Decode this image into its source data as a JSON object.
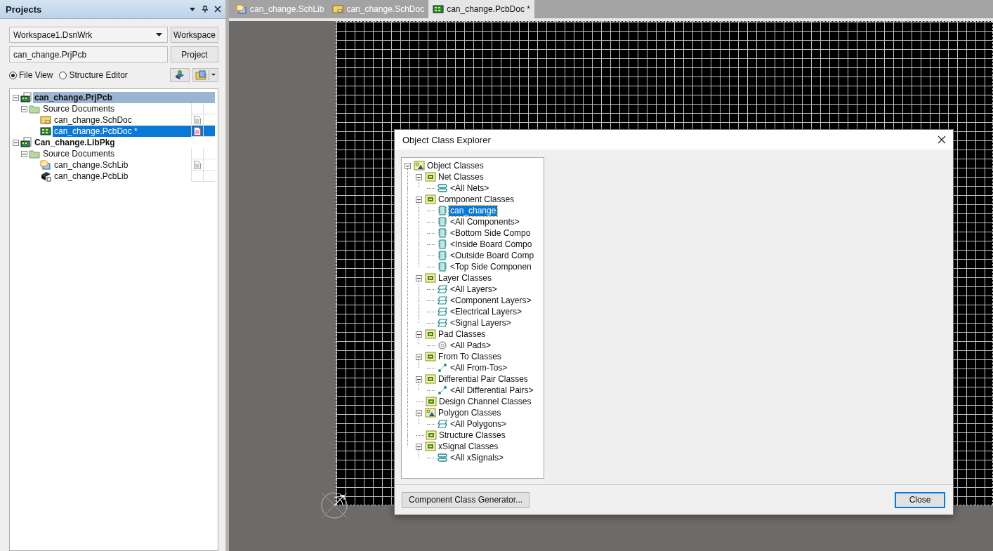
{
  "projects_panel": {
    "title": "Projects",
    "workspace_field": {
      "value": "Workspace1.DsnWrk"
    },
    "workspace_button": "Workspace",
    "project_field": {
      "value": "can_change.PrjPcb"
    },
    "project_button": "Project",
    "view_options": [
      {
        "label": "File View",
        "selected": true
      },
      {
        "label": "Structure Editor",
        "selected": false
      }
    ],
    "tree": [
      {
        "label": "can_change.PrjPcb",
        "kind": "project",
        "expanded": true,
        "selected": true,
        "children": [
          {
            "label": "Source Documents",
            "kind": "folder",
            "expanded": true,
            "selected": false,
            "children": [
              {
                "label": "can_change.SchDoc",
                "kind": "schdoc",
                "selected": false,
                "modified": false
              },
              {
                "label": "can_change.PcbDoc *",
                "kind": "pcbdoc",
                "selected": true,
                "modified": true
              }
            ]
          }
        ]
      },
      {
        "label": "Can_change.LibPkg",
        "kind": "project",
        "expanded": true,
        "selected": false,
        "children": [
          {
            "label": "Source Documents",
            "kind": "folder",
            "expanded": true,
            "selected": false,
            "children": [
              {
                "label": "can_change.SchLib",
                "kind": "schlib",
                "selected": false,
                "modified": false
              },
              {
                "label": "can_change.PcbLib",
                "kind": "pcblib",
                "selected": false
              }
            ]
          }
        ]
      }
    ]
  },
  "document_tabs": [
    {
      "label": "can_change.SchLib",
      "kind": "schlib",
      "selected": false
    },
    {
      "label": "can_change.SchDoc",
      "kind": "schdoc",
      "selected": false
    },
    {
      "label": "can_change.PcbDoc *",
      "kind": "pcbdoc",
      "selected": true
    }
  ],
  "dialog": {
    "title": "Object Class Explorer",
    "tree": [
      {
        "label": "Object Classes",
        "kind": "object",
        "expanded": true,
        "selected": false,
        "children": [
          {
            "label": "Net Classes",
            "kind": "folder",
            "expanded": true,
            "selected": false,
            "children": [
              {
                "label": "<All Nets>",
                "kind": "net",
                "selected": false
              }
            ]
          },
          {
            "label": "Component Classes",
            "kind": "folder",
            "expanded": true,
            "selected": false,
            "children": [
              {
                "label": "can_change",
                "kind": "component",
                "selected": true
              },
              {
                "label": "<All Components>",
                "kind": "component",
                "selected": false
              },
              {
                "label": "<Bottom Side Compo",
                "kind": "component",
                "selected": false
              },
              {
                "label": "<Inside Board Compo",
                "kind": "component",
                "selected": false
              },
              {
                "label": "<Outside Board Comp",
                "kind": "component",
                "selected": false
              },
              {
                "label": "<Top Side Componen",
                "kind": "component",
                "selected": false
              }
            ]
          },
          {
            "label": "Layer Classes",
            "kind": "folder",
            "expanded": true,
            "selected": false,
            "children": [
              {
                "label": "<All Layers>",
                "kind": "layer",
                "selected": false
              },
              {
                "label": "<Component Layers>",
                "kind": "layer",
                "selected": false
              },
              {
                "label": "<Electrical Layers>",
                "kind": "layer",
                "selected": false
              },
              {
                "label": "<Signal Layers>",
                "kind": "layer",
                "selected": false
              }
            ]
          },
          {
            "label": "Pad Classes",
            "kind": "folder",
            "expanded": true,
            "selected": false,
            "children": [
              {
                "label": "<All Pads>",
                "kind": "pad",
                "selected": false
              }
            ]
          },
          {
            "label": "From To Classes",
            "kind": "folder",
            "expanded": true,
            "selected": false,
            "children": [
              {
                "label": "<All From-Tos>",
                "kind": "fromto",
                "selected": false
              }
            ]
          },
          {
            "label": "Differential Pair Classes",
            "kind": "folder",
            "expanded": true,
            "selected": false,
            "children": [
              {
                "label": "<All Differential Pairs>",
                "kind": "fromto",
                "selected": false
              }
            ]
          },
          {
            "label": "Design Channel Classes",
            "kind": "folder",
            "selected": false
          },
          {
            "label": "Polygon Classes",
            "kind": "object",
            "expanded": true,
            "selected": false,
            "children": [
              {
                "label": "<All Polygons>",
                "kind": "layer",
                "selected": false
              }
            ]
          },
          {
            "label": "Structure Classes",
            "kind": "folder",
            "selected": false
          },
          {
            "label": "xSignal Classes",
            "kind": "folder",
            "expanded": true,
            "selected": false,
            "children": [
              {
                "label": "<All xSignals>",
                "kind": "net",
                "selected": false
              }
            ]
          }
        ]
      }
    ],
    "buttons": [
      {
        "label": "Component Class Generator...",
        "kind": "normal"
      },
      {
        "label": "Close",
        "kind": "default"
      }
    ]
  }
}
